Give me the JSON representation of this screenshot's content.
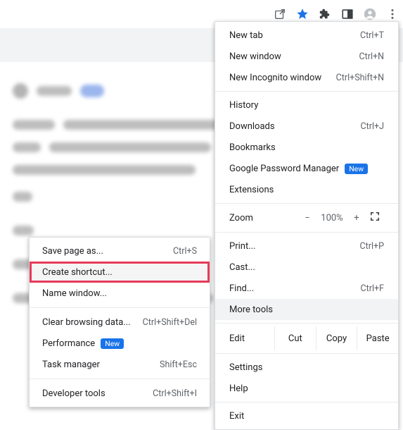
{
  "toolbar": {
    "share_tooltip": "Share",
    "star_tooltip": "Bookmark",
    "ext_tooltip": "Extensions",
    "panel_tooltip": "Side panel",
    "profile_tooltip": "Profile",
    "menu_tooltip": "Customize and control Google Chrome"
  },
  "menu": {
    "newtab": {
      "label": "New tab",
      "shortcut": "Ctrl+T"
    },
    "newwin": {
      "label": "New window",
      "shortcut": "Ctrl+N"
    },
    "incog": {
      "label": "New Incognito window",
      "shortcut": "Ctrl+Shift+N"
    },
    "history": {
      "label": "History"
    },
    "downloads": {
      "label": "Downloads",
      "shortcut": "Ctrl+J"
    },
    "bookmarks": {
      "label": "Bookmarks"
    },
    "gpm": {
      "label": "Google Password Manager",
      "badge": "New"
    },
    "extensions": {
      "label": "Extensions"
    },
    "zoom": {
      "label": "Zoom",
      "minus": "−",
      "value": "100%",
      "plus": "+"
    },
    "print": {
      "label": "Print...",
      "shortcut": "Ctrl+P"
    },
    "cast": {
      "label": "Cast..."
    },
    "find": {
      "label": "Find...",
      "shortcut": "Ctrl+F"
    },
    "moretools": {
      "label": "More tools"
    },
    "edit": {
      "label": "Edit",
      "cut": "Cut",
      "copy": "Copy",
      "paste": "Paste"
    },
    "settings": {
      "label": "Settings"
    },
    "help": {
      "label": "Help"
    },
    "exit": {
      "label": "Exit"
    }
  },
  "submenu": {
    "savepage": {
      "label": "Save page as...",
      "shortcut": "Ctrl+S"
    },
    "createshortcut": {
      "label": "Create shortcut..."
    },
    "namewindow": {
      "label": "Name window..."
    },
    "clearbrowsing": {
      "label": "Clear browsing data...",
      "shortcut": "Ctrl+Shift+Del"
    },
    "performance": {
      "label": "Performance",
      "badge": "New"
    },
    "taskmanager": {
      "label": "Task manager",
      "shortcut": "Shift+Esc"
    },
    "devtools": {
      "label": "Developer tools",
      "shortcut": "Ctrl+Shift+I"
    }
  }
}
